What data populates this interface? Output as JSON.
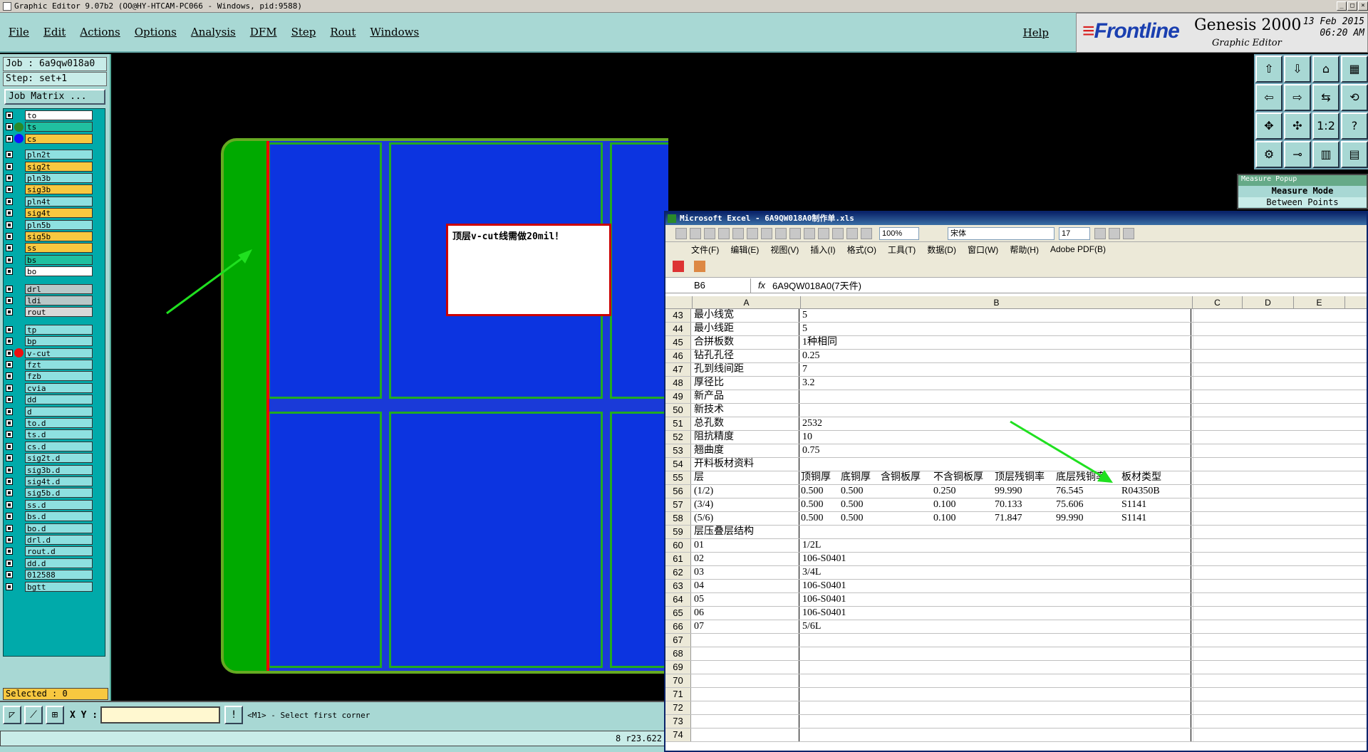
{
  "window": {
    "title": "Graphic Editor 9.07b2 (OO@HY-HTCAM-PC066 - Windows, pid:9588)"
  },
  "menu": {
    "items": [
      "File",
      "Edit",
      "Actions",
      "Options",
      "Analysis",
      "DFM",
      "Step",
      "Rout",
      "Windows"
    ],
    "help": "Help"
  },
  "brand": {
    "logo": "Frontline",
    "product": "Genesis 2000",
    "subtitle": "Graphic Editor",
    "date": "13 Feb 2015",
    "time": "06:20 AM"
  },
  "job": {
    "job": "Job : 6a9qw018a0",
    "step": "Step: set+1",
    "matrix_button": "Job Matrix ..."
  },
  "layers": [
    {
      "name": "to",
      "color": "#ffffff",
      "dot": ""
    },
    {
      "name": "ts",
      "color": "#20c0a0",
      "dot": "#2a8a2a"
    },
    {
      "name": "cs",
      "color": "#f8c840",
      "dot": "#1010ff",
      "active": true
    },
    {
      "name": "pln2t",
      "color": "#8ee0e0",
      "dot": ""
    },
    {
      "name": "sig2t",
      "color": "#f8c840",
      "dot": ""
    },
    {
      "name": "pln3b",
      "color": "#8ee0e0",
      "dot": ""
    },
    {
      "name": "sig3b",
      "color": "#f8c840",
      "dot": ""
    },
    {
      "name": "pln4t",
      "color": "#8ee0e0",
      "dot": ""
    },
    {
      "name": "sig4t",
      "color": "#f8c840",
      "dot": ""
    },
    {
      "name": "pln5b",
      "color": "#8ee0e0",
      "dot": ""
    },
    {
      "name": "sig5b",
      "color": "#f8c840",
      "dot": ""
    },
    {
      "name": "ss",
      "color": "#f8c840",
      "dot": ""
    },
    {
      "name": "bs",
      "color": "#20c0a0",
      "dot": ""
    },
    {
      "name": "bo",
      "color": "#ffffff",
      "dot": ""
    },
    {
      "name": "drl",
      "color": "#b8c8c8",
      "dot": ""
    },
    {
      "name": "ldi",
      "color": "#b8c8c8",
      "dot": ""
    },
    {
      "name": "rout",
      "color": "#d8d8d8",
      "dot": ""
    },
    {
      "name": "tp",
      "color": "#8ee0e0",
      "dot": ""
    },
    {
      "name": "bp",
      "color": "#8ee0e0",
      "dot": ""
    },
    {
      "name": "v-cut",
      "color": "#8ee0e0",
      "dot": "#ee1010"
    },
    {
      "name": "fzt",
      "color": "#8ee0e0",
      "dot": ""
    },
    {
      "name": "fzb",
      "color": "#8ee0e0",
      "dot": ""
    },
    {
      "name": "cvia",
      "color": "#8ee0e0",
      "dot": ""
    },
    {
      "name": "dd",
      "color": "#8ee0e0",
      "dot": ""
    },
    {
      "name": "d",
      "color": "#8ee0e0",
      "dot": ""
    },
    {
      "name": "to.d",
      "color": "#8ee0e0",
      "dot": ""
    },
    {
      "name": "ts.d",
      "color": "#8ee0e0",
      "dot": ""
    },
    {
      "name": "cs.d",
      "color": "#8ee0e0",
      "dot": ""
    },
    {
      "name": "sig2t.d",
      "color": "#8ee0e0",
      "dot": ""
    },
    {
      "name": "sig3b.d",
      "color": "#8ee0e0",
      "dot": ""
    },
    {
      "name": "sig4t.d",
      "color": "#8ee0e0",
      "dot": ""
    },
    {
      "name": "sig5b.d",
      "color": "#8ee0e0",
      "dot": ""
    },
    {
      "name": "ss.d",
      "color": "#8ee0e0",
      "dot": ""
    },
    {
      "name": "bs.d",
      "color": "#8ee0e0",
      "dot": ""
    },
    {
      "name": "bo.d",
      "color": "#8ee0e0",
      "dot": ""
    },
    {
      "name": "drl.d",
      "color": "#8ee0e0",
      "dot": ""
    },
    {
      "name": "rout.d",
      "color": "#8ee0e0",
      "dot": ""
    },
    {
      "name": "dd.d",
      "color": "#8ee0e0",
      "dot": ""
    },
    {
      "name": "012588",
      "color": "#8ee0e0",
      "dot": ""
    },
    {
      "name": "bgtt",
      "color": "#8ee0e0",
      "dot": ""
    }
  ],
  "selected": "Selected : 0",
  "note": "顶层v-cut线需做20mil！",
  "xy": {
    "label": "X Y :",
    "value": "",
    "message": "<M1> - Select first corner",
    "coords": "8 r23.622"
  },
  "measure": {
    "title": "Measure Popup",
    "mode": "Measure Mode",
    "between": "Between Points"
  },
  "excel": {
    "title": "Microsoft Excel - 6A9QW018A0制作单.xls",
    "zoom": "100%",
    "font": "宋体",
    "size": "17",
    "menu": [
      "文件(F)",
      "编辑(E)",
      "视图(V)",
      "插入(I)",
      "格式(O)",
      "工具(T)",
      "数据(D)",
      "窗口(W)",
      "帮助(H)",
      "Adobe PDF(B)"
    ],
    "cell_ref": "B6",
    "formula": "6A9QW018A0(7天件)",
    "columns": [
      "A",
      "B",
      "C",
      "D",
      "E"
    ],
    "rows": [
      {
        "n": "43",
        "a": "最小线宽",
        "b": "5"
      },
      {
        "n": "44",
        "a": "最小线距",
        "b": "5"
      },
      {
        "n": "45",
        "a": "合拼板数",
        "b": "1种相同"
      },
      {
        "n": "46",
        "a": "钻孔孔径",
        "b": "0.25"
      },
      {
        "n": "47",
        "a": "孔到线间距",
        "b": "7"
      },
      {
        "n": "48",
        "a": "厚径比",
        "b": "3.2"
      },
      {
        "n": "49",
        "a": "新产品",
        "b": ""
      },
      {
        "n": "50",
        "a": "新技术",
        "b": ""
      },
      {
        "n": "51",
        "a": "总孔数",
        "b": "2532"
      },
      {
        "n": "52",
        "a": "阻抗精度",
        "b": "10"
      },
      {
        "n": "53",
        "a": "翘曲度",
        "b": "0.75"
      },
      {
        "n": "54",
        "a": "开料板材资料",
        "b": ""
      },
      {
        "n": "55",
        "a": "层",
        "cols": [
          "顶铜厚",
          "底铜厚",
          "含铜板厚",
          "不含铜板厚",
          "顶层残铜率",
          "底层残铜率",
          "板材类型"
        ]
      },
      {
        "n": "56",
        "a": "(1/2)",
        "cols": [
          "0.500",
          "0.500",
          "",
          "0.250",
          "99.990",
          "76.545",
          "R04350B"
        ]
      },
      {
        "n": "57",
        "a": "(3/4)",
        "cols": [
          "0.500",
          "0.500",
          "",
          "0.100",
          "70.133",
          "75.606",
          "S1141"
        ]
      },
      {
        "n": "58",
        "a": "(5/6)",
        "cols": [
          "0.500",
          "0.500",
          "",
          "0.100",
          "71.847",
          "99.990",
          "S1141"
        ]
      },
      {
        "n": "59",
        "a": "层压叠层结构",
        "b": ""
      },
      {
        "n": "60",
        "a": "01",
        "b": "1/2L"
      },
      {
        "n": "61",
        "a": "02",
        "b": "106-S0401"
      },
      {
        "n": "62",
        "a": "03",
        "b": "3/4L"
      },
      {
        "n": "63",
        "a": "04",
        "b": "106-S0401"
      },
      {
        "n": "64",
        "a": "05",
        "b": "106-S0401"
      },
      {
        "n": "65",
        "a": "06",
        "b": "106-S0401"
      },
      {
        "n": "66",
        "a": "07",
        "b": "5/6L"
      },
      {
        "n": "67",
        "a": "",
        "b": ""
      },
      {
        "n": "68",
        "a": "",
        "b": ""
      },
      {
        "n": "69",
        "a": "",
        "b": ""
      },
      {
        "n": "70",
        "a": "",
        "b": ""
      },
      {
        "n": "71",
        "a": "",
        "b": ""
      },
      {
        "n": "72",
        "a": "",
        "b": ""
      },
      {
        "n": "73",
        "a": "",
        "b": ""
      },
      {
        "n": "74",
        "a": "",
        "b": ""
      }
    ]
  }
}
